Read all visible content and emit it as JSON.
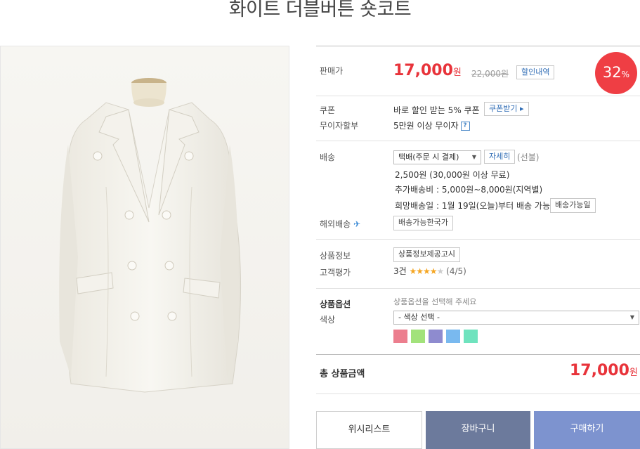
{
  "product": {
    "title": "화이트 더블버튼 숏코트"
  },
  "price": {
    "label": "판매가",
    "sale": "17,000",
    "unit": "원",
    "original": "22,000원",
    "discount_button": "할인내역",
    "discount_rate": "32",
    "discount_suffix": "%"
  },
  "coupon": {
    "label": "쿠폰",
    "text": "바로 할인 받는 5% 쿠폰",
    "button": "쿠폰받기 ▸"
  },
  "installment": {
    "label": "무이자할부",
    "text": "5만원 이상 무이자",
    "help": "?"
  },
  "shipping": {
    "label": "배송",
    "method": "택배(주문 시 결제)",
    "detail_button": "자세히",
    "prepaid": "(선불)",
    "fee": "2,500원 (30,000원 이상 무료)",
    "extra": "추가배송비 : 5,000원~8,000원(지역별)",
    "wish_date": "희망배송일 : 1월 19일(오늘)부터 배송 가능",
    "available_button": "배송가능일"
  },
  "overseas": {
    "label": "해외배송",
    "button": "배송가능한국가"
  },
  "product_info": {
    "label": "상품정보",
    "button": "상품정보제공고시"
  },
  "review": {
    "label": "고객평가",
    "count": "3건",
    "stars_on": "★★★★",
    "stars_off": "★",
    "score": "(4/5)"
  },
  "options": {
    "label": "상품옵션",
    "hint": "상품옵션을 선택해 주세요",
    "color_label": "색상",
    "color_select": "- 색상 선택 -",
    "swatches": [
      "#ec7e8e",
      "#a2e27b",
      "#8e8bcf",
      "#79b9ef",
      "#6fe3be"
    ]
  },
  "total": {
    "label": "총 상품금액",
    "value": "17,000",
    "unit": "원"
  },
  "buttons": {
    "wishlist": "위시리스트",
    "cart": "장바구니",
    "buy": "구매하기"
  },
  "colors": {
    "accent_red": "#e8333a",
    "cart_bg": "#6c7a9c",
    "buy_bg": "#7d93cf"
  }
}
